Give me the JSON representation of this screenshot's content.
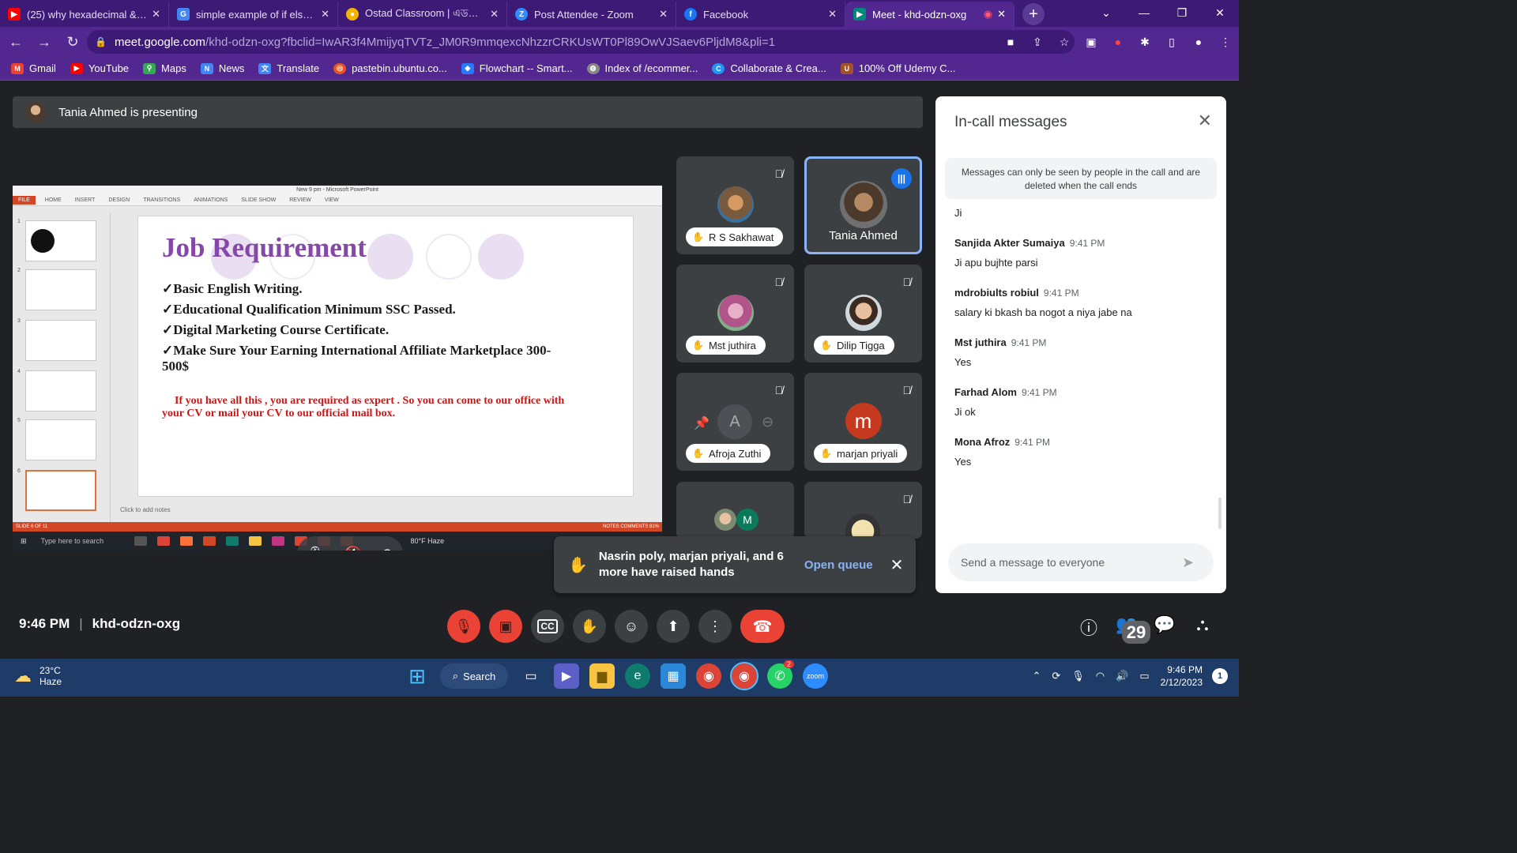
{
  "browser": {
    "tabs": [
      {
        "title": "(25) why hexadecimal & oc",
        "icon": "youtube-icon",
        "color": "#ff0000"
      },
      {
        "title": "simple example of if else st",
        "icon": "google-icon",
        "color": "#4285f4"
      },
      {
        "title": "Ostad Classroom | এডভান্স",
        "icon": "ostad-icon",
        "color": "#f4b400"
      },
      {
        "title": "Post Attendee - Zoom",
        "icon": "zoom-icon",
        "color": "#2d8cff"
      },
      {
        "title": "Facebook",
        "icon": "facebook-icon",
        "color": "#1877f2"
      },
      {
        "title": "Meet - khd-odzn-oxg",
        "icon": "meet-icon",
        "color": "#00897b",
        "active": true
      }
    ],
    "url_host": "meet.google.com",
    "url_path": "/khd-odzn-oxg?fbclid=IwAR3f4MmijyqTVTz_JM0R9mmqexcNhzzrCRKUsWT0Pl89OwVJSaev6PljdM8&pli=1",
    "bookmarks": [
      {
        "label": "Gmail",
        "color": "#ea4335"
      },
      {
        "label": "YouTube",
        "color": "#ff0000"
      },
      {
        "label": "Maps",
        "color": "#34a853"
      },
      {
        "label": "News",
        "color": "#4285f4"
      },
      {
        "label": "Translate",
        "color": "#4285f4"
      },
      {
        "label": "pastebin.ubuntu.co...",
        "color": "#e95420"
      },
      {
        "label": "Flowchart -- Smart...",
        "color": "#2979ff"
      },
      {
        "label": "Index of /ecommer...",
        "color": "#888888"
      },
      {
        "label": "Collaborate & Crea...",
        "color": "#2196f3"
      },
      {
        "label": "100% Off Udemy C...",
        "color": "#a0522d"
      }
    ]
  },
  "meet": {
    "presenting_text": "Tania Ahmed is presenting",
    "time": "9:46 PM",
    "code": "khd-odzn-oxg",
    "participants_count": "29",
    "tiles": [
      {
        "name": "R S Sakhawat",
        "pill": true
      },
      {
        "name": "Tania Ahmed",
        "pill": false,
        "speaking": true
      },
      {
        "name": "Mst juthira",
        "pill": true
      },
      {
        "name": "Dilip Tigga",
        "pill": true
      },
      {
        "name": "Afroja Zuthi",
        "pill": true
      },
      {
        "name": "marjan priyali",
        "pill": true,
        "initial": "m"
      },
      {
        "name": "",
        "pill": false,
        "initial": "M"
      },
      {
        "name": "",
        "pill": false
      }
    ],
    "toast": {
      "message": "Nasrin poly, marjan priyali, and 6 more have raised hands",
      "action": "Open queue"
    },
    "chat": {
      "title": "In-call messages",
      "notice": "Messages can only be seen by people in the call and are deleted when the call ends",
      "messages": [
        {
          "sender": "",
          "time": "",
          "text": "Ji"
        },
        {
          "sender": "Sanjida Akter Sumaiya",
          "time": "9:41 PM",
          "text": "Ji apu bujhte parsi"
        },
        {
          "sender": "mdrobiults robiul",
          "time": "9:41 PM",
          "text": "salary ki bkash ba nogot a niya jabe na"
        },
        {
          "sender": "Mst juthira",
          "time": "9:41 PM",
          "text": "Yes"
        },
        {
          "sender": "Farhad Alom",
          "time": "9:41 PM",
          "text": "Ji ok"
        },
        {
          "sender": "Mona Afroz",
          "time": "9:41 PM",
          "text": "Yes"
        }
      ],
      "placeholder": "Send a message to everyone"
    }
  },
  "powerpoint": {
    "window_title": "New 9 pm - Microsoft PowerPoint",
    "ribbon": [
      "FILE",
      "HOME",
      "INSERT",
      "DESIGN",
      "TRANSITIONS",
      "ANIMATIONS",
      "SLIDE SHOW",
      "REVIEW",
      "VIEW"
    ],
    "slide_title": "Job Requirement",
    "bullets": [
      "✓Basic English Writing.",
      "✓Educational Qualification Minimum SSC Passed.",
      "✓Digital Marketing Course Certificate.",
      "✓Make Sure Your Earning International Affiliate Marketplace 300-500$"
    ],
    "note_red": "If you have all this , you are required as expert . So you can come to our office with your CV or mail your CV to our official mail box.",
    "notes_placeholder": "Click to add notes",
    "status_left": "SLIDE 6 OF 11",
    "status_right": "NOTES   COMMENTS   81%",
    "thumb_numbers": [
      "1",
      "2",
      "3",
      "4",
      "5",
      "6"
    ],
    "inner_search": "Type here to search",
    "inner_weather": "80°F  Haze"
  },
  "taskbar": {
    "temp": "23°C",
    "condition": "Haze",
    "search_label": "Search",
    "clock_time": "9:46 PM",
    "clock_date": "2/12/2023",
    "whatsapp_badge": "2",
    "notification_count": "1"
  }
}
